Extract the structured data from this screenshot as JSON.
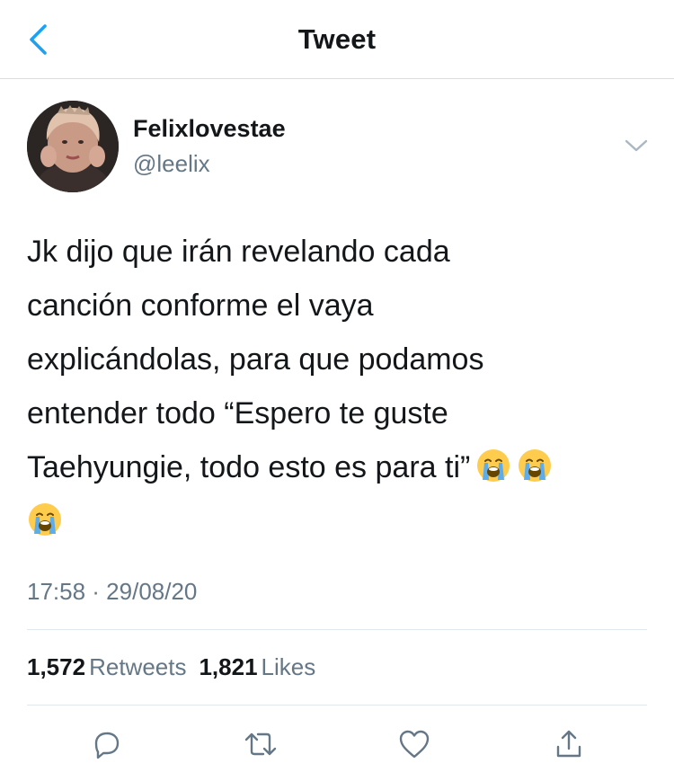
{
  "header": {
    "title": "Tweet",
    "back_icon": "chevron-left-icon"
  },
  "author": {
    "name": "Felixlovestae",
    "handle": "@leelix"
  },
  "tweet": {
    "lines": [
      "Jk dijo que irán revelando cada",
      "canción conforme el vaya",
      "explicándolas, para que podamos",
      "entender todo “Espero te guste",
      "Taehyungie, todo esto es para ti”"
    ],
    "emoji": "loudly-crying-face",
    "emoji_count": 3,
    "timestamp": "17:58 · 29/08/20"
  },
  "stats": {
    "retweets_count": "1,572",
    "retweets_label": "Retweets",
    "likes_count": "1,821",
    "likes_label": "Likes"
  },
  "actions": [
    "reply-icon",
    "retweet-icon",
    "like-icon",
    "share-icon"
  ],
  "colors": {
    "accent": "#1da1f2",
    "text": "#14171a",
    "secondary": "#657786",
    "divider": "#e1e8ed"
  }
}
